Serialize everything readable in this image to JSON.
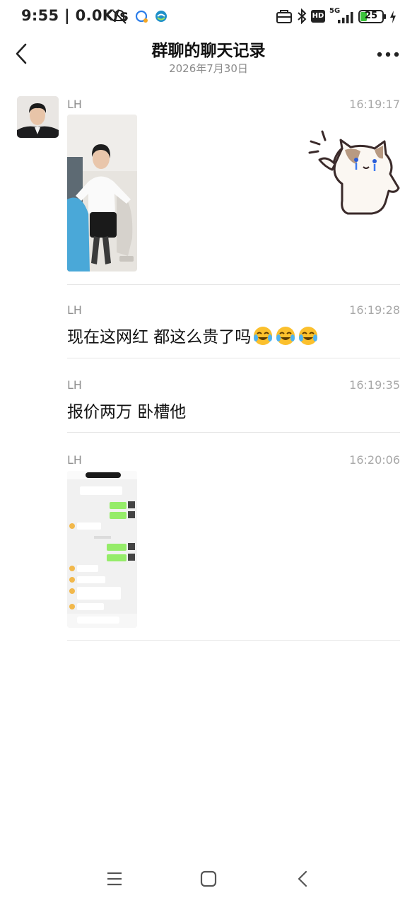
{
  "status_bar": {
    "time": "9:55 | 0.0K/s",
    "network": "5G",
    "hd_badge": "HD",
    "battery": "25",
    "icons": [
      "mute-icon",
      "chat-app-icon",
      "china-mobile-icon",
      "wallet-icon",
      "bluetooth-icon",
      "signal-icon",
      "charging-icon"
    ]
  },
  "header": {
    "title": "群聊的聊天记录",
    "subtitle": "2026年7月30日",
    "back_icon": "chevron-left-icon",
    "more_icon": "more-dots-icon"
  },
  "messages": [
    {
      "sender": "LH",
      "time": "16:19:17",
      "type": "image",
      "content": "woman-in-office-photo"
    },
    {
      "sender": "LH",
      "time": "16:19:28",
      "type": "text",
      "text": "现在这网红 都这么贵了吗",
      "emojis": [
        "laugh-cry-emoji",
        "laugh-cry-emoji",
        "laugh-cry-emoji"
      ]
    },
    {
      "sender": "LH",
      "time": "16:19:35",
      "type": "text",
      "text": "报价两万 卧槽他"
    },
    {
      "sender": "LH",
      "time": "16:20:06",
      "type": "image",
      "content": "chat-screenshot-image"
    }
  ],
  "sticker": {
    "name": "cat-sticker"
  },
  "colors": {
    "accent_green": "#95ec69",
    "battery_green": "#3cc23c",
    "muted_text": "#8f8f8f"
  },
  "bottom_nav": [
    "menu-icon",
    "home-icon",
    "back-icon"
  ]
}
